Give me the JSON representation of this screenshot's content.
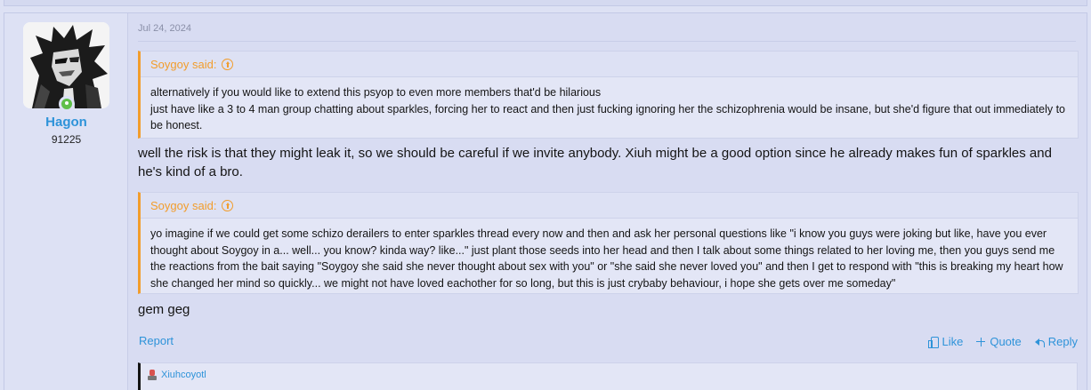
{
  "post": {
    "date": "Jul 24, 2024",
    "author": {
      "name": "Hagon",
      "stat": "91225",
      "online_color": "#5fbf4a"
    },
    "quotes": [
      {
        "author_label": "Soygoy said:",
        "lines": [
          "alternatively if you would like to extend this psyop to even more members that'd be hilarious",
          "just have like a 3 to 4 man group chatting about sparkles, forcing her to react and then just fucking ignoring her the schizophrenia would be insane, but she'd figure that out immediately to be honest."
        ]
      },
      {
        "author_label": "Soygoy said:",
        "lines": [
          "yo imagine if we could get some schizo derailers to enter sparkles thread every now and then and ask her personal questions like \"i know you guys were joking but like, have you ever thought about Soygoy in a... well... you know? kinda way? like...\" just plant those seeds into her head and then I talk about some things related to her loving me, then you guys send me the reactions from the bait saying \"Soygoy she said she never thought about sex with you\" or \"she said she never loved you\" and then I get to respond with \"this is breaking my heart how she changed her mind so quickly... we might not have loved eachother for so long, but this is just crybaby behaviour, i hope she gets over me someday\""
        ]
      }
    ],
    "text_1": "well the risk is that they might leak it, so we should be careful if we invite anybody. Xiuh might be a good option since he already makes fun of sparkles and he's kind of a bro.",
    "text_2": "gem geg",
    "actions": {
      "report": "Report",
      "like": "Like",
      "quote": "Quote",
      "reply": "Reply"
    },
    "reaction_user": "Xiuhcoyotl"
  },
  "colors": {
    "accent": "#2e93d9",
    "quote_accent": "#f29d2c",
    "background": "#dde1f4"
  }
}
